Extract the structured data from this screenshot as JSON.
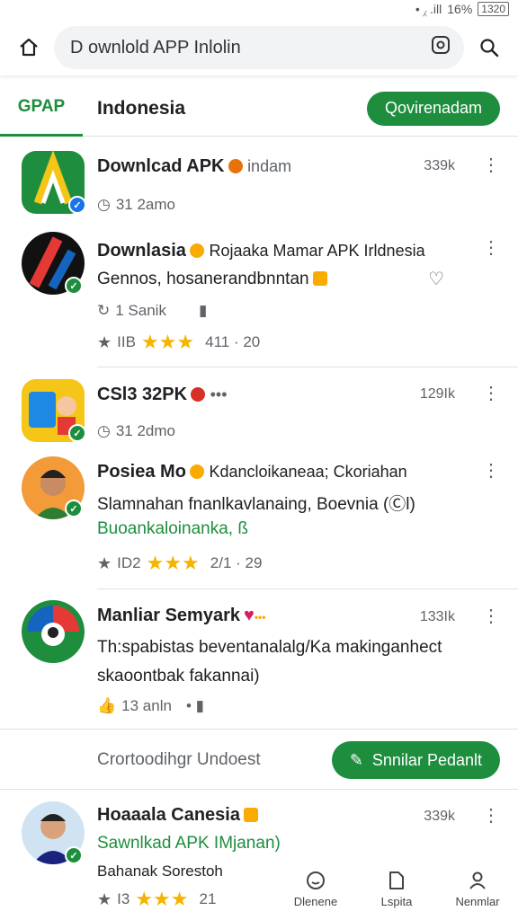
{
  "status": {
    "icons": "• ⁁ .ill",
    "battery": "16%",
    "battery_box": "1320"
  },
  "browser": {
    "url": "D ownlold APP Inlolin",
    "home_icon": "home-icon",
    "search_icon": "search-icon"
  },
  "site": {
    "logo": "GPAP",
    "title": "Indonesia",
    "header_button": "Qovirenadam"
  },
  "apps": [
    {
      "title": "Downlcad APK",
      "subtitle": "indam",
      "size": "339k",
      "meta": "31 2amo"
    },
    {
      "title": "Downlasia",
      "title_rest": "Rojaaka Mamar APK Irldnesia",
      "desc": "Gennos, hosanerandbnntan",
      "meta": "1 Sanik",
      "rating_text": "IIB",
      "rating_value": "411 · 20"
    },
    {
      "title": "CSl3 32PK",
      "suffix": "•••",
      "size": "129Ik",
      "meta": "31 2dmo"
    },
    {
      "title": "Posiea Mo",
      "title_rest": "Kdancloikaneaa; Ckoriahan",
      "desc": "Slamnahan fnanlkavlanaing, Boevnia (Ⓒl)",
      "desc_green": "Buoankaloinanka, ß",
      "rating_text": "ID2",
      "rating_value": "2/1 · 29"
    },
    {
      "title": "Manliar Semyark",
      "size": "133Ik",
      "desc": "Th:spabistas beventanalalg/Ka makinganhect",
      "desc2": "skaoontbak fakannai)",
      "meta": "13 anln"
    },
    {
      "title": "Hoaaala Canesia",
      "size": "339k",
      "desc_green": "Sawnlkad APK IMjanan)",
      "meta": "Bahanak Sorestoh",
      "rating_text": "I3",
      "rating_value": "21"
    }
  ],
  "more": {
    "text": "Crortoodihgr Undoest",
    "button": "Snnilar Pedanlt"
  },
  "nav": [
    {
      "label": "Dlenene",
      "icon": "smiley-icon"
    },
    {
      "label": "Lspita",
      "icon": "folder-icon"
    },
    {
      "label": "Nenmlar",
      "icon": "person-icon"
    }
  ],
  "colors": {
    "accent": "#1e8e3e",
    "star": "#f4b400",
    "verified": "#1a73e8"
  }
}
